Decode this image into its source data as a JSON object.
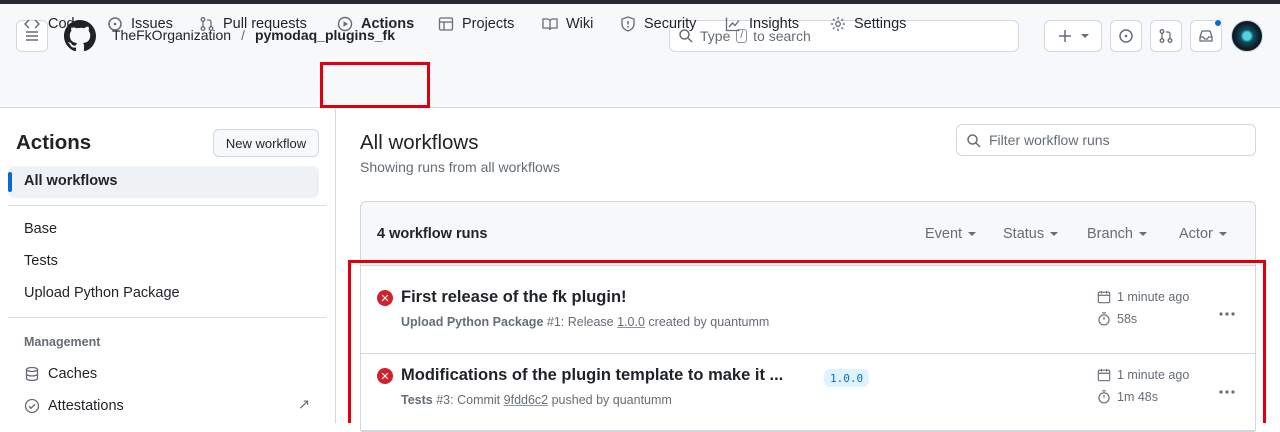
{
  "header": {
    "org": "TheFkOrganization",
    "separator": "/",
    "repo": "pymodaq_plugins_fk",
    "search_prefix": "Type",
    "search_key": "/",
    "search_suffix": "to search"
  },
  "tabs": [
    {
      "label": "Code",
      "icon": "code-icon"
    },
    {
      "label": "Issues",
      "icon": "issue-opened-icon"
    },
    {
      "label": "Pull requests",
      "icon": "git-pull-request-icon"
    },
    {
      "label": "Actions",
      "icon": "play-icon",
      "active": true
    },
    {
      "label": "Projects",
      "icon": "table-icon"
    },
    {
      "label": "Wiki",
      "icon": "book-icon"
    },
    {
      "label": "Security",
      "icon": "shield-icon"
    },
    {
      "label": "Insights",
      "icon": "graph-icon"
    },
    {
      "label": "Settings",
      "icon": "gear-icon"
    }
  ],
  "sidebar": {
    "title": "Actions",
    "new_workflow": "New workflow",
    "all_workflows": "All workflows",
    "workflows": [
      "Base",
      "Tests",
      "Upload Python Package"
    ],
    "management_heading": "Management",
    "management": [
      {
        "label": "Caches",
        "icon": "database-icon"
      },
      {
        "label": "Attestations",
        "icon": "verified-icon",
        "arrow": "↗"
      }
    ]
  },
  "main": {
    "title": "All workflows",
    "subtitle": "Showing runs from all workflows",
    "filter_placeholder": "Filter workflow runs",
    "runs_count": "4 workflow runs",
    "filters": [
      "Event",
      "Status",
      "Branch",
      "Actor"
    ],
    "runs": [
      {
        "status": "failure",
        "title": "First release of the fk plugin!",
        "workflow": "Upload Python Package",
        "run_number": "#1:",
        "event_text": "Release",
        "ref": "1.0.0",
        "actor_text": "created by quantumm",
        "tag": "",
        "time_ago": "1 minute ago",
        "duration": "58s"
      },
      {
        "status": "failure",
        "title": "Modifications of the plugin template to make it ...",
        "workflow": "Tests",
        "run_number": "#3:",
        "event_text": "Commit",
        "ref": "9fdd6c2",
        "actor_text": "pushed by quantumm",
        "tag": "1.0.0",
        "time_ago": "1 minute ago",
        "duration": "1m 48s"
      }
    ]
  },
  "colors": {
    "failure": "#cf222e",
    "accent": "#0969da",
    "highlight_box": "#e0000d"
  }
}
